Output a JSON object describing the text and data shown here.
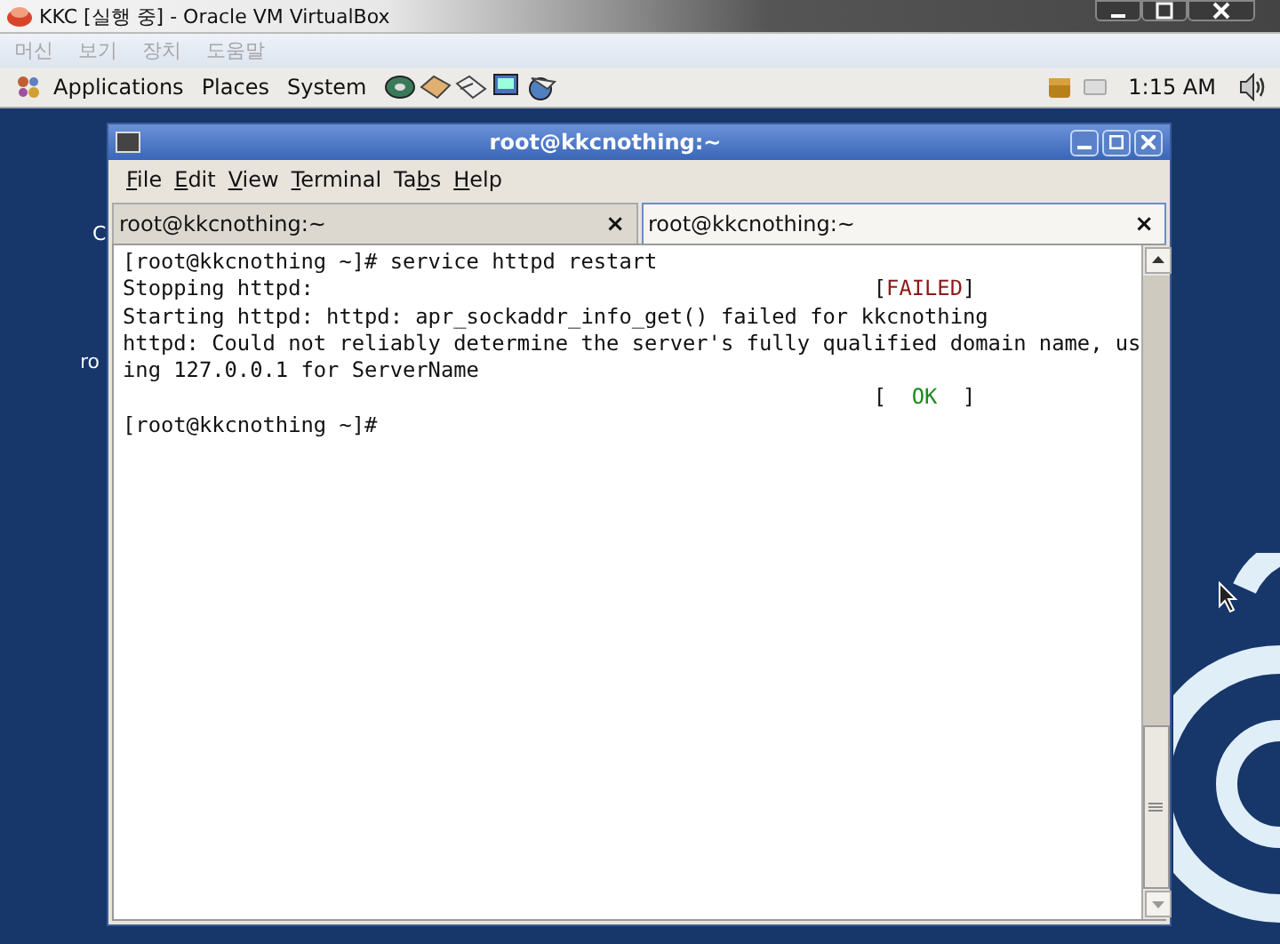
{
  "host_window": {
    "title": "KKC [실행 중] - Oracle VM VirtualBox",
    "menu": [
      {
        "label": "머신",
        "disabled": true
      },
      {
        "label": "보기",
        "disabled": true
      },
      {
        "label": "장치",
        "disabled": true
      },
      {
        "label": "도움말",
        "disabled": true
      }
    ]
  },
  "panel": {
    "menus": [
      "Applications",
      "Places",
      "System"
    ],
    "clock": "1:15 AM"
  },
  "desktop": {
    "labels": [
      "C",
      "ro"
    ]
  },
  "terminal": {
    "title": "root@kkcnothing:~",
    "menu": [
      {
        "key": "F",
        "after": "ile"
      },
      {
        "key": "E",
        "after": "dit"
      },
      {
        "key": "V",
        "after": "iew"
      },
      {
        "key": "T",
        "after": "erminal"
      },
      {
        "before": "Ta",
        "key": "b",
        "after": "s"
      },
      {
        "key": "H",
        "after": "elp"
      }
    ],
    "tabs": [
      {
        "label": "root@kkcnothing:~",
        "close": "×",
        "selected": false
      },
      {
        "label": "root@kkcnothing:~",
        "close": "×",
        "selected": true
      }
    ],
    "lines": [
      {
        "text": "[root@kkcnothing ~]# service httpd restart"
      },
      {
        "text": "Stopping httpd:",
        "status": {
          "open": "[",
          "word": "FAILED",
          "close": "]",
          "kind": "failed"
        }
      },
      {
        "text": "Starting httpd: httpd: apr_sockaddr_info_get() failed for kkcnothing"
      },
      {
        "text": "httpd: Could not reliably determine the server's fully qualified domain name, us"
      },
      {
        "text": "ing 127.0.0.1 for ServerName"
      },
      {
        "status": {
          "open": "[  ",
          "word": "OK",
          "close": "  ]",
          "kind": "ok"
        }
      },
      {
        "text": "[root@kkcnothing ~]#"
      }
    ]
  }
}
